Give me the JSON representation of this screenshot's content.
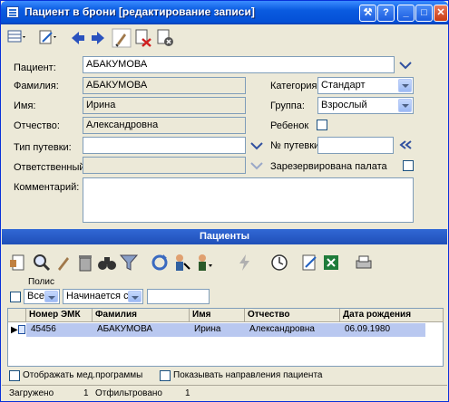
{
  "window": {
    "title": "Пациент в брони [редактирование записи]"
  },
  "form": {
    "patient_label": "Пациент:",
    "patient_value": "АБАКУМОВА",
    "lastname_label": "Фамилия:",
    "lastname_value": "АБАКУМОВА",
    "firstname_label": "Имя:",
    "firstname_value": "Ирина",
    "middlename_label": "Отчество:",
    "middlename_value": "Александровна",
    "trip_type_label": "Тип путевки:",
    "trip_type_value": "",
    "responsible_label": "Ответственный:",
    "responsible_value": "",
    "comment_label": "Комментарий:",
    "comment_value": "",
    "category_label": "Категория:",
    "category_value": "Стандарт",
    "group_label": "Группа:",
    "group_value": "Взрослый",
    "child_label": "Ребенок",
    "trip_number_label": "№ путевки:",
    "trip_number_value": "",
    "room_reserved_label": "Зарезервирована палата"
  },
  "patients": {
    "header": "Пациенты",
    "filter": {
      "field_label": "Полис",
      "scope": "Все",
      "mode": "Начинается с",
      "value": ""
    },
    "columns": [
      "Номер ЭМК",
      "Фамилия",
      "Имя",
      "Отчество",
      "Дата рождения"
    ],
    "rows": [
      {
        "emk": "45456",
        "lastname": "АБАКУМОВА",
        "firstname": "Ирина",
        "middlename": "Александровна",
        "birthdate": "06.09.1980"
      }
    ],
    "show_med_programs": "Отображать мед.программы",
    "show_directions": "Показывать направления пациента"
  },
  "status": {
    "loaded_label": "Загружено",
    "loaded_count": "1",
    "filtered_label": "Отфильтровано",
    "filtered_count": "1"
  },
  "colors": {
    "title_blue": "#0a5be0",
    "selection": "#b9c8f0",
    "section_header": "#3168d5"
  }
}
